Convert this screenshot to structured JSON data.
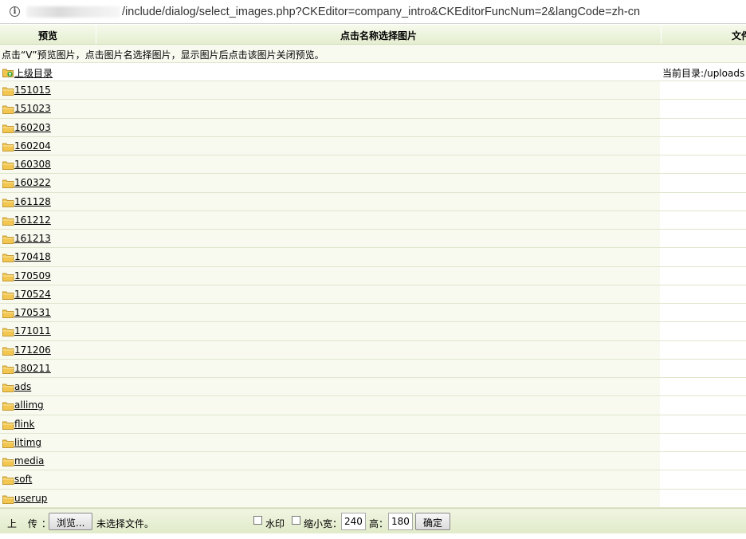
{
  "address_bar": {
    "url": "/include/dialog/select_images.php?CKEditor=company_intro&CKEditorFuncNum=2&langCode=zh-cn"
  },
  "header": {
    "preview": "预览",
    "name": "点击名称选择图片",
    "file": "文件"
  },
  "tip": "点击“V”预览图片，点击图片名选择图片，显示图片后点击该图片关闭预览。",
  "parent": {
    "label": "上级目录",
    "current_dir": "当前目录:/uploads"
  },
  "folders": [
    "151015",
    "151023",
    "160203",
    "160204",
    "160308",
    "160322",
    "161128",
    "161212",
    "161213",
    "170418",
    "170509",
    "170524",
    "170531",
    "171011",
    "171206",
    "180211",
    "ads",
    "allimg",
    "flink",
    "litimg",
    "media",
    "soft",
    "userup"
  ],
  "upload": {
    "label": "上 传：",
    "browse_button": "浏览...",
    "no_file": "未选择文件。",
    "watermark_label": "水印",
    "thumb_width_label": "缩小宽：",
    "width_value": "240",
    "height_label": "高：",
    "height_value": "180",
    "ok_button": "确定"
  },
  "colors": {
    "header_bg": "#e8f0d6",
    "row_bg": "#f8faf0",
    "border": "#dfe6cd",
    "folder": "#f2c64f"
  }
}
